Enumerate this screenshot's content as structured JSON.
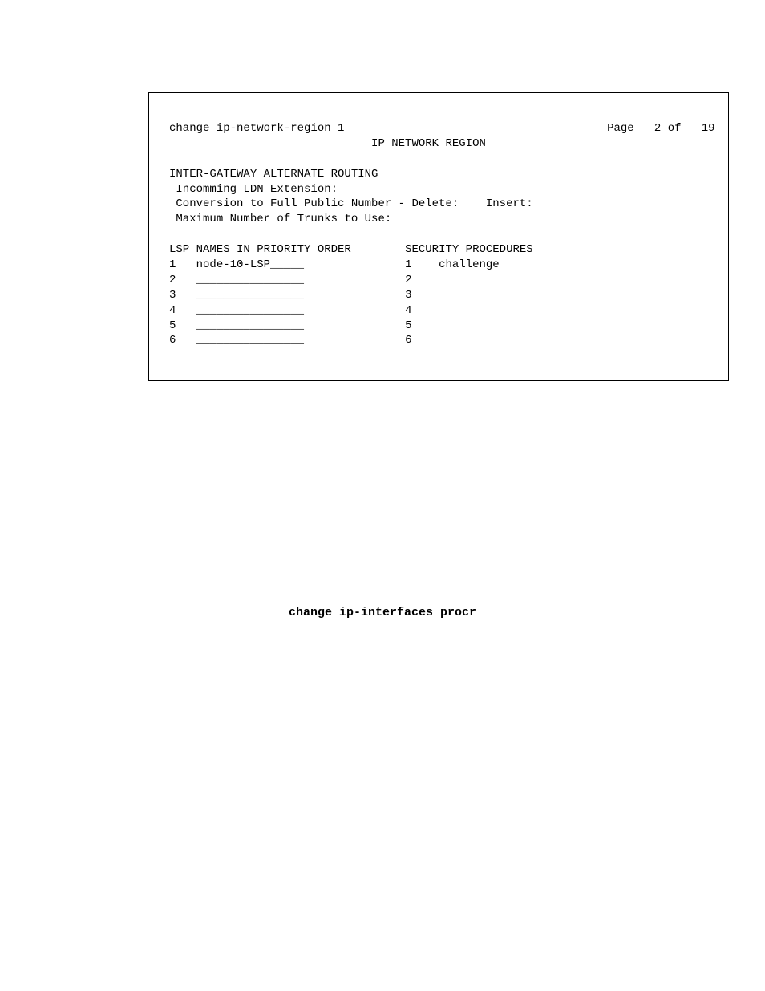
{
  "terminal": {
    "command": "change ip-network-region 1",
    "page_label": "Page",
    "page_current": "2",
    "page_of": "of",
    "page_total": "19",
    "title": "IP NETWORK REGION",
    "section1_heading": "INTER-GATEWAY ALTERNATE ROUTING",
    "s1_line1": "Incomming LDN Extension:",
    "s1_line2": "Conversion to Full Public Number - Delete:    Insert:",
    "s1_line3": "Maximum Number of Trunks to Use:",
    "lsp_heading": "LSP NAMES IN PRIORITY ORDER",
    "sec_heading": "SECURITY PROCEDURES",
    "lsp_rows": [
      {
        "num": "1",
        "name": "node-10-LSP_____"
      },
      {
        "num": "2",
        "name": "________________"
      },
      {
        "num": "3",
        "name": "________________"
      },
      {
        "num": "4",
        "name": "________________"
      },
      {
        "num": "5",
        "name": "________________"
      },
      {
        "num": "6",
        "name": "________________"
      }
    ],
    "sec_rows": [
      {
        "num": "1",
        "name": "challenge"
      },
      {
        "num": "2",
        "name": ""
      },
      {
        "num": "3",
        "name": ""
      },
      {
        "num": "4",
        "name": ""
      },
      {
        "num": "5",
        "name": ""
      },
      {
        "num": "6",
        "name": ""
      }
    ]
  },
  "command_title": "change ip-interfaces procr"
}
